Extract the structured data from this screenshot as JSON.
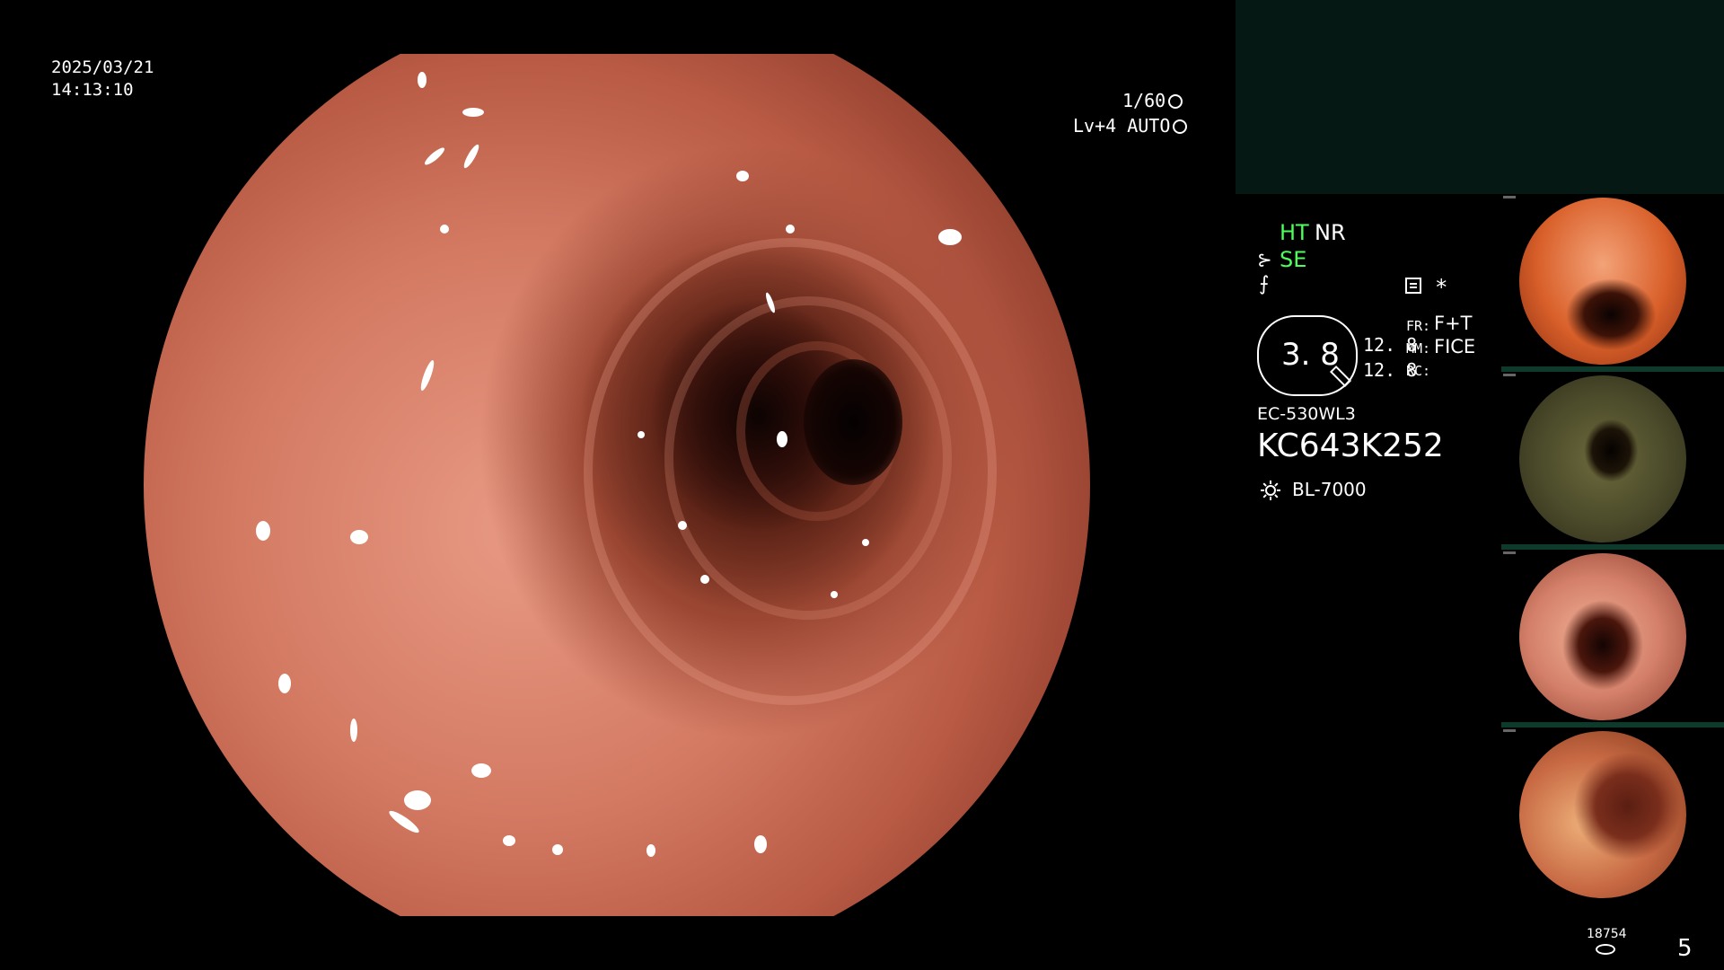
{
  "overlay": {
    "date": "2025/03/21",
    "time": "14:13:10",
    "shutter": "1/60",
    "level": "Lv+4 AUTO"
  },
  "status": {
    "ht": "HT",
    "nr": "NR",
    "se": "SE",
    "se_icon": "scope-tip-icon",
    "f_icon": "freeze-icon",
    "mode_icon": "record-mode-icon",
    "asterisk": "*"
  },
  "zoom": {
    "value": "3. 8"
  },
  "readouts": {
    "value1": "12. 8",
    "value2": "12. 8",
    "fr_label": "FR:",
    "fr_value": "F+T",
    "mm_label": "MM:",
    "mm_value": "FICE",
    "rc_label": "RC:"
  },
  "device": {
    "scope_model": "EC-530WL3",
    "serial": "KC643K252",
    "light_source": "BL-7000"
  },
  "thumbnails": {
    "count": 4,
    "image_count": "18754",
    "page_number": "5"
  },
  "colors": {
    "accent_green": "#4cff5a",
    "preview_panel": "#051814",
    "thumb_bar": "#0e3a2c"
  }
}
